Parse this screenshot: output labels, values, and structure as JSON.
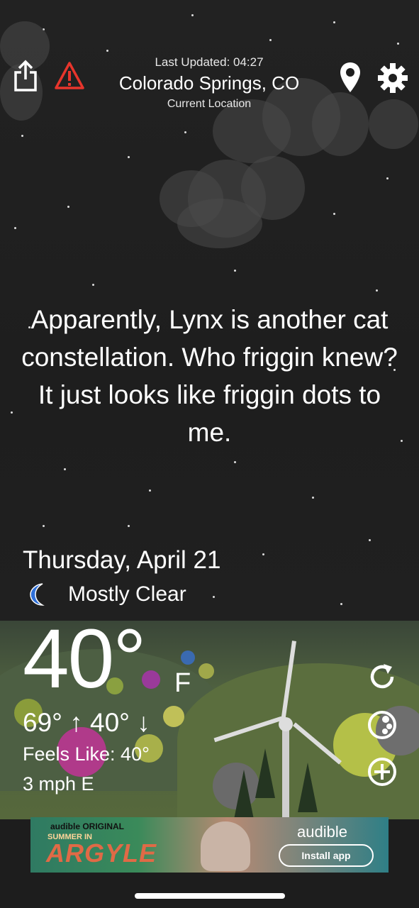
{
  "header": {
    "last_updated": "Last Updated: 04:27",
    "location": "Colorado Springs, CO",
    "sub_location": "Current Location",
    "icons": [
      "share-icon",
      "alert-icon",
      "map-pin-icon",
      "gear-icon"
    ]
  },
  "quote": "Apparently, Lynx is another cat constellation. Who friggin knew? It just looks like friggin dots to me.",
  "weather": {
    "date": "Thursday, April 21",
    "condition": "Mostly Clear",
    "condition_icon": "moon-icon",
    "temperature": "40°",
    "unit": "F",
    "hilo": "69° ↑  40° ↓",
    "feels_like": "Feels Like: 40°",
    "wind": "3 mph E"
  },
  "side_buttons": [
    "refresh-icon",
    "radar-icon",
    "add-icon"
  ],
  "ad": {
    "small_label": "audible ORIGINAL",
    "subtitle": "SUMMER IN",
    "title": "ARGYLE",
    "brand": "audible",
    "cta": "Install app"
  },
  "colors": {
    "sky": "#1e1e1e",
    "alert": "#e8352c",
    "moon": "#2e6fd8"
  }
}
